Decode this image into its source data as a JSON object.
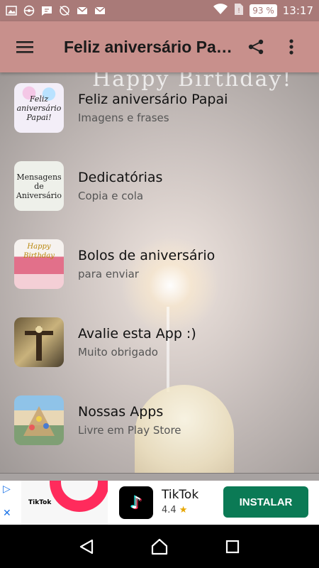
{
  "status_bar": {
    "battery": "93 %",
    "time": "13:17",
    "icons": [
      "gallery-icon",
      "pokeball-icon",
      "message-icon",
      "sync-off-icon",
      "gmail-icon",
      "gmail-icon",
      "wifi-icon",
      "no-sim-icon",
      "battery-icon"
    ]
  },
  "app_bar": {
    "title": "Feliz aniversário Papai",
    "icons": [
      "menu-icon",
      "share-icon",
      "more-vertical-icon"
    ]
  },
  "background": {
    "text": "Happy Birthday!"
  },
  "list": [
    {
      "title": "Feliz aniversário Papai",
      "subtitle": "Imagens e frases",
      "thumb_text": "Feliz aniversário Papai!"
    },
    {
      "title": "Dedicatórias",
      "subtitle": "Copia e cola",
      "thumb_text": "Mensagens de Aniversário"
    },
    {
      "title": "Bolos de aniversário",
      "subtitle": "para enviar",
      "thumb_text": "Happy Birthday"
    },
    {
      "title": "Avalie esta App :)",
      "subtitle": "Muito obrigado",
      "thumb_text": ""
    },
    {
      "title": "Nossas Apps",
      "subtitle": "Livre em Play Store",
      "thumb_text": ""
    }
  ],
  "ad": {
    "image_label": "TikTok",
    "app_name": "TikTok",
    "rating": "4.4",
    "install_label": "INSTALAR",
    "adchoices_icon": "adchoices-icon",
    "close_icon": "close-icon"
  },
  "nav_bar": {
    "icons": [
      "back-icon",
      "home-icon",
      "recents-icon"
    ]
  },
  "colors": {
    "status_bar": "#a97a78",
    "app_bar": "#c8908c",
    "install_button": "#0b7a55",
    "tiktok_ring": "#ff2b5c"
  }
}
